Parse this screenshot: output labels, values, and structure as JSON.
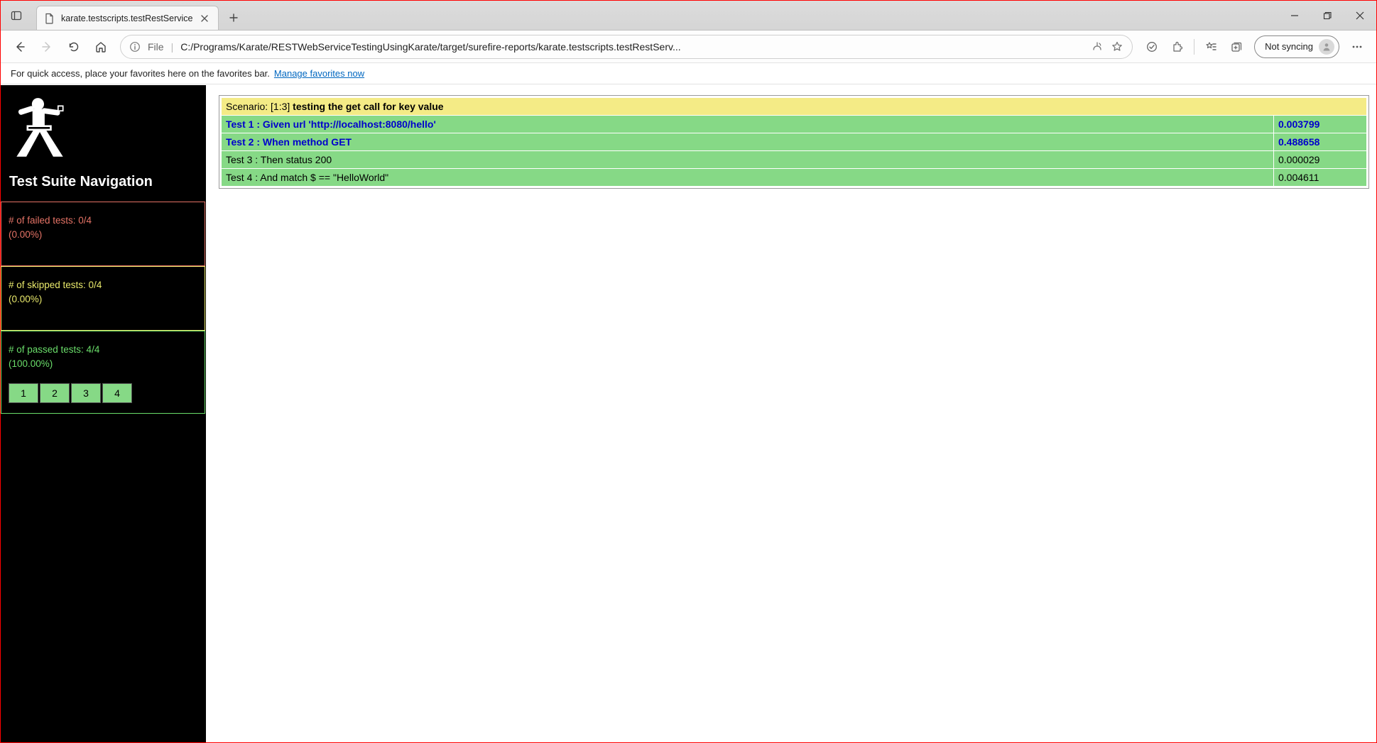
{
  "browser": {
    "tab_title": "karate.testscripts.testRestService",
    "file_label": "File",
    "url": "C:/Programs/Karate/RESTWebServiceTestingUsingKarate/target/surefire-reports/karate.testscripts.testRestServ...",
    "not_syncing": "Not syncing",
    "bookmark_hint": "For quick access, place your favorites here on the favorites bar.",
    "manage_favorites": "Manage favorites now"
  },
  "sidebar": {
    "title": "Test Suite Navigation",
    "failed_line1": "# of failed tests: 0/4",
    "failed_line2": "(0.00%)",
    "skipped_line1": "# of skipped tests: 0/4",
    "skipped_line2": "(0.00%)",
    "passed_line1": "# of passed tests: 4/4",
    "passed_line2": "(100.00%)",
    "pass_links": [
      "1",
      "2",
      "3",
      "4"
    ]
  },
  "report": {
    "scenario_prefix": "Scenario: [1:3] ",
    "scenario_name": "testing the get call for key value",
    "steps": [
      {
        "label": "Test 1 : Given url 'http://localhost:8080/hello'",
        "time": "0.003799",
        "bold": true
      },
      {
        "label": "Test 2 : When method GET",
        "time": "0.488658",
        "bold": true
      },
      {
        "label": "Test 3 : Then status 200",
        "time": "0.000029",
        "bold": false
      },
      {
        "label": "Test 4 : And match $ == \"HelloWorld\"",
        "time": "0.004611",
        "bold": false
      }
    ]
  }
}
